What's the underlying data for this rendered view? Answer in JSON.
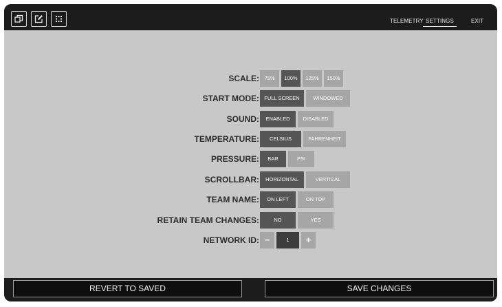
{
  "toolbar": {
    "icons": [
      "window-restore-icon",
      "edit-layout-icon",
      "grid-icon"
    ]
  },
  "nav": {
    "telemetry": "TELEMETRY",
    "settings": "SETTINGS",
    "exit": "EXIT",
    "active": "settings"
  },
  "settings": {
    "scale": {
      "label": "SCALE:",
      "options": [
        "75%",
        "100%",
        "125%",
        "150%"
      ],
      "selected": "100%"
    },
    "start_mode": {
      "label": "START MODE:",
      "options": [
        "FULL SCREEN",
        "WINDOWED"
      ],
      "selected": "FULL SCREEN"
    },
    "sound": {
      "label": "SOUND:",
      "options": [
        "ENABLED",
        "DISABLED"
      ],
      "selected": "ENABLED"
    },
    "temperature": {
      "label": "TEMPERATURE:",
      "options": [
        "CELSIUS",
        "FAHRENHEIT"
      ],
      "selected": "CELSIUS"
    },
    "pressure": {
      "label": "PRESSURE:",
      "options": [
        "BAR",
        "PSI"
      ],
      "selected": "BAR"
    },
    "scrollbar": {
      "label": "SCROLLBAR:",
      "options": [
        "HORIZONTAL",
        "VERTICAL"
      ],
      "selected": "HORIZONTAL"
    },
    "team_name": {
      "label": "TEAM NAME:",
      "options": [
        "ON LEFT",
        "ON TOP"
      ],
      "selected": "ON LEFT"
    },
    "retain_team_changes": {
      "label": "RETAIN TEAM CHANGES:",
      "options": [
        "NO",
        "YES"
      ],
      "selected": "NO"
    },
    "network_id": {
      "label": "NETWORK ID:",
      "value": "1",
      "decrement": "−",
      "increment": "+"
    }
  },
  "actions": {
    "revert": "REVERT TO SAVED",
    "save": "SAVE CHANGES"
  },
  "colors": {
    "background": "#c8c8c8",
    "bar": "#1c1c1c",
    "option_selected": "#555555",
    "option_unselected": "#a6a6a6"
  }
}
